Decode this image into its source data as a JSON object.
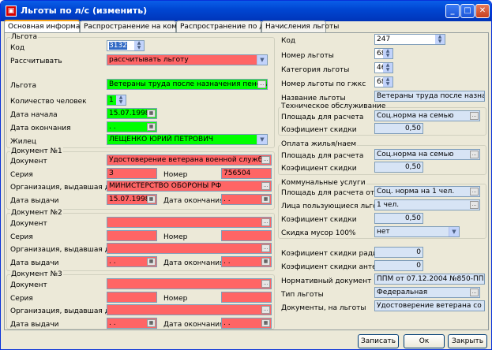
{
  "window": {
    "title": "Льготы по л/с (изменить)"
  },
  "tabs": [
    "Основная информация",
    "Распространение на ком. усл.",
    "Распространение по долям",
    "Начисления льготы"
  ],
  "left": {
    "group_title": "Льгота",
    "kod_label": "Код",
    "kod_value": "3132",
    "raschet_label": "Рассчитывать",
    "raschet_value": "рассчитывать льготу",
    "lgota_label": "Льгота",
    "lgota_value": "Ветераны труда после назначения пенсии по ос",
    "kolvo_label": "Количество человек",
    "kolvo_value": "1",
    "dstart_label": "Дата начала",
    "dstart_value": "15.07.1998",
    "dend_label": "Дата окончания",
    "dend_value": " .  . ",
    "zhilec_label": "Жилец",
    "zhilec_value": "ЛЕЩЕНКО ЮРИЙ  ПЕТРОВИЧ",
    "doc1": {
      "title": "Документ №1",
      "doc_label": "Документ",
      "doc_value": "Удостоверение ветерана военной службы",
      "ser_label": "Серия",
      "ser_value": "З",
      "nom_label": "Номер",
      "nom_value": "756504",
      "org_label": "Организация, выдавшая док.",
      "org_value": "МИНИСТЕРСТВО ОБОРОНЫ РФ",
      "dv_label": "Дата выдачи",
      "dv_value": "15.07.1998",
      "do_label": "Дата окончания",
      "do_value": " .  . "
    },
    "doc2": {
      "title": "Документ №2",
      "doc_label": "Документ",
      "doc_value": "",
      "ser_label": "Серия",
      "ser_value": "",
      "nom_label": "Номер",
      "nom_value": "",
      "org_label": "Организация, выдавшая док.",
      "org_value": "",
      "dv_label": "Дата выдачи",
      "dv_value": " .  . ",
      "do_label": "Дата окончания",
      "do_value": " .  . "
    },
    "doc3": {
      "title": "Документ №3",
      "doc_label": "Документ",
      "doc_value": "",
      "ser_label": "Серия",
      "ser_value": "",
      "nom_label": "Номер",
      "nom_value": "",
      "org_label": "Организация, выдавшая док.",
      "org_value": "",
      "dv_label": "Дата выдачи",
      "dv_value": " .  . ",
      "do_label": "Дата окончания",
      "do_value": " .  . "
    }
  },
  "right": {
    "kod_label": "Код",
    "kod_value": "247",
    "nomer_label": "Номер льготы",
    "nomer_value": "68",
    "kat_label": "Категория льготы",
    "kat_value": "46",
    "gzhks_label": "Номер льготы по гжкс",
    "gzhks_value": "68",
    "name_label": "Название льготы",
    "name_value": "Ветераны труда после назначения",
    "tech": {
      "title": "Техническое обслуживание",
      "area_label": "Площадь для расчета",
      "area_value": "Соц.норма на семью",
      "coef_label": "Коэфициент скидки",
      "coef_value": "0,50"
    },
    "oplata": {
      "title": "Оплата жилья/наем",
      "area_label": "Площадь для расчета",
      "area_value": "Соц.норма на семью",
      "coef_label": "Коэфициент скидки",
      "coef_value": "0,50"
    },
    "komm": {
      "title": "Коммунальные услуги",
      "area_label": "Площадь для расчета отоплени",
      "area_value": "Соц. норма на 1 чел.",
      "persons_label": "Лица пользующиеся льготой",
      "persons_value": "1 чел.",
      "coef_label": "Коэфициент скидки",
      "coef_value": "0,50",
      "musor_label": "Скидка мусор 100%",
      "musor_value": "нет"
    },
    "radio_label": "Коэфициент скидки радио",
    "radio_value": "0",
    "antenna_label": "Коэфициент скидки антенна",
    "antenna_value": "0",
    "norm_label": "Нормативный документ",
    "norm_value": "ППМ от 07.12.2004 №850-ПП",
    "type_label": "Тип льготы",
    "type_value": "Федеральная",
    "docs_label": "Документы, на льготы",
    "docs_value": "Удостоверение ветерана со ссылк"
  },
  "buttons": {
    "save": "Записать",
    "ok": "Ок",
    "close": "Закрыть"
  },
  "colors": {
    "required": "#ff6565",
    "valid": "#00ff00",
    "readonly": "#d7e4f5"
  }
}
